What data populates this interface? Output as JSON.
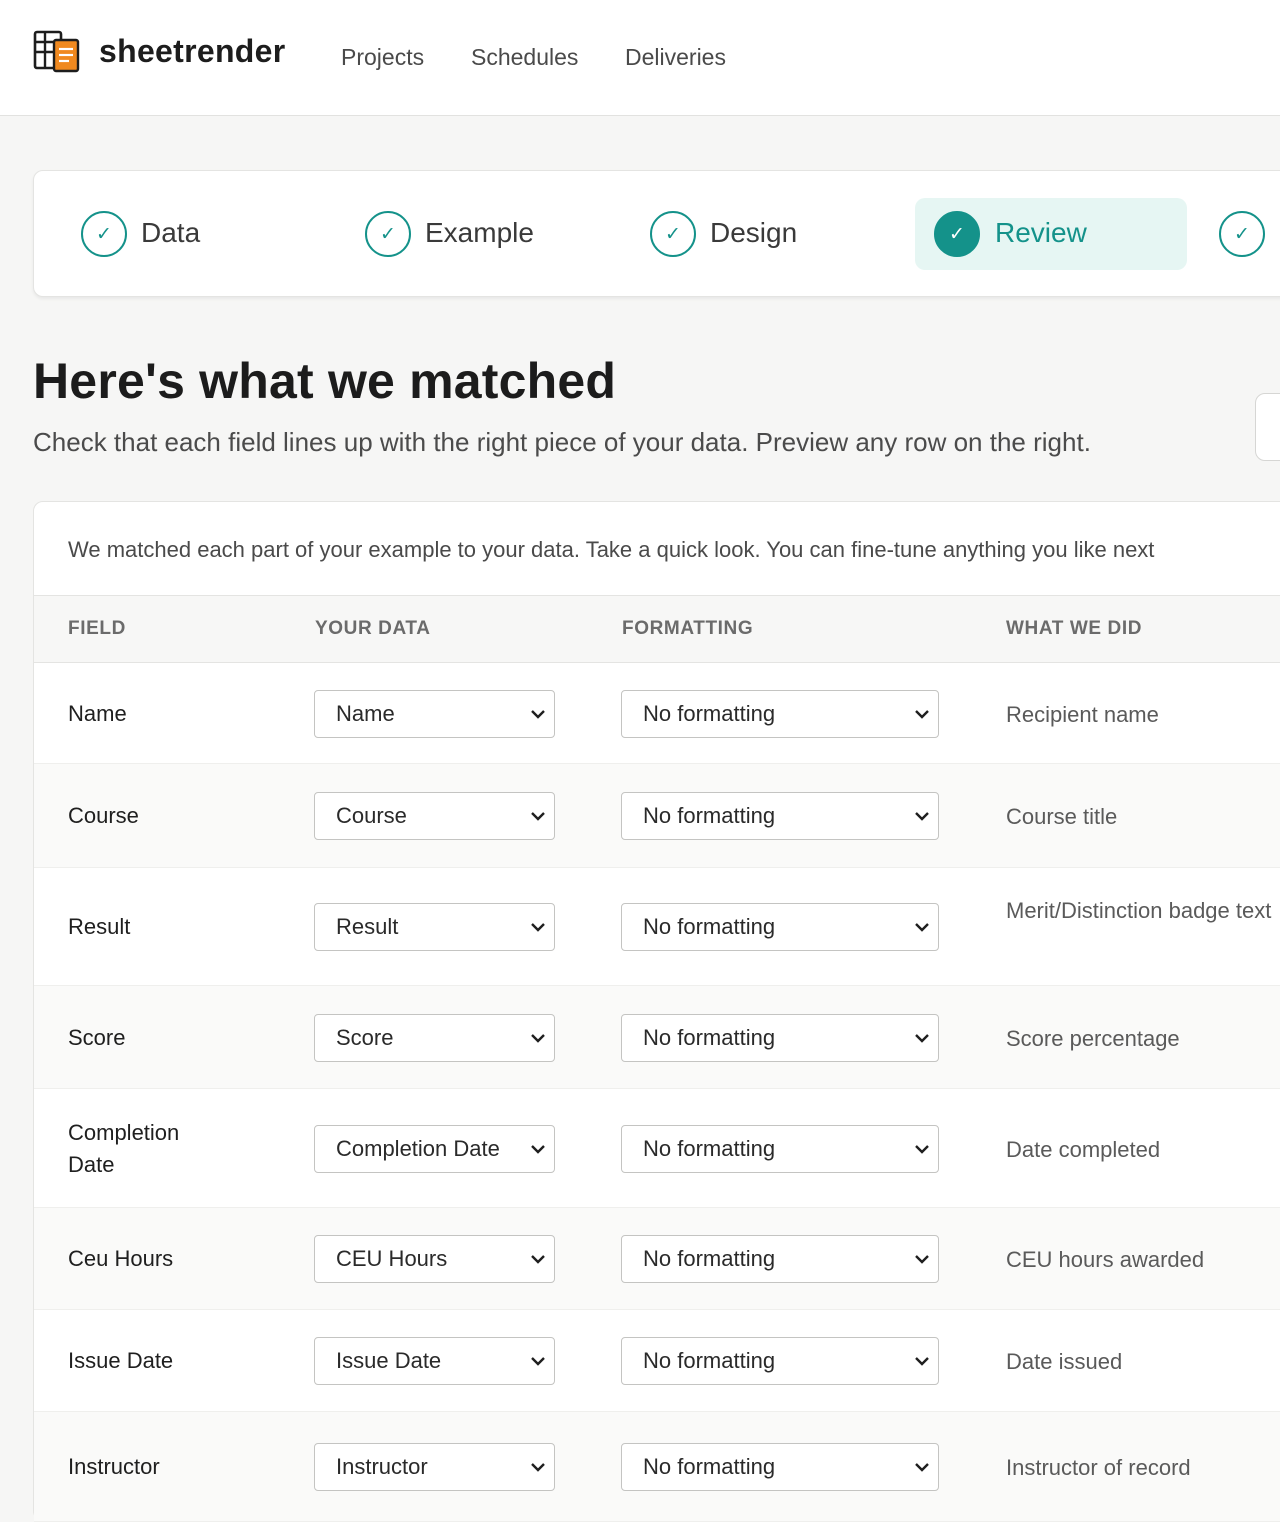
{
  "header": {
    "brand": "sheetrender",
    "nav": [
      "Projects",
      "Schedules",
      "Deliveries"
    ]
  },
  "stepper": {
    "steps": [
      {
        "label": "Data",
        "state": "done"
      },
      {
        "label": "Example",
        "state": "done"
      },
      {
        "label": "Design",
        "state": "done"
      },
      {
        "label": "Review",
        "state": "active"
      },
      {
        "label": "",
        "state": "done"
      }
    ],
    "check_glyph": "✓"
  },
  "page": {
    "title": "Here's what we matched",
    "subtitle": "Check that each field lines up with the right piece of your data. Preview any row on the right."
  },
  "card": {
    "intro": "We matched each part of your example to your data. Take a quick look. You can fine-tune anything you like next",
    "columns": [
      "FIELD",
      "YOUR DATA",
      "FORMATTING",
      "WHAT WE DID"
    ],
    "rows": [
      {
        "field": "Name",
        "data": "Name",
        "formatting": "No formatting",
        "what": "Recipient name"
      },
      {
        "field": "Course",
        "data": "Course",
        "formatting": "No formatting",
        "what": "Course title"
      },
      {
        "field": "Result",
        "data": "Result",
        "formatting": "No formatting",
        "what": "Merit/Distinction badge text"
      },
      {
        "field": "Score",
        "data": "Score",
        "formatting": "No formatting",
        "what": "Score percentage"
      },
      {
        "field": "Completion Date",
        "data": "Completion Date",
        "formatting": "No formatting",
        "what": "Date completed"
      },
      {
        "field": "Ceu Hours",
        "data": "CEU Hours",
        "formatting": "No formatting",
        "what": "CEU hours awarded"
      },
      {
        "field": "Issue Date",
        "data": "Issue Date",
        "formatting": "No formatting",
        "what": "Date issued"
      },
      {
        "field": "Instructor",
        "data": "Instructor",
        "formatting": "No formatting",
        "what": "Instructor of record"
      }
    ]
  },
  "colors": {
    "accent": "#14928a",
    "accent_bg": "#e6f6f3",
    "logo_orange": "#f0891f"
  },
  "icons": {
    "logo": "spreadsheet-document-icon",
    "step": "check-icon",
    "select": "chevron-down-icon"
  }
}
